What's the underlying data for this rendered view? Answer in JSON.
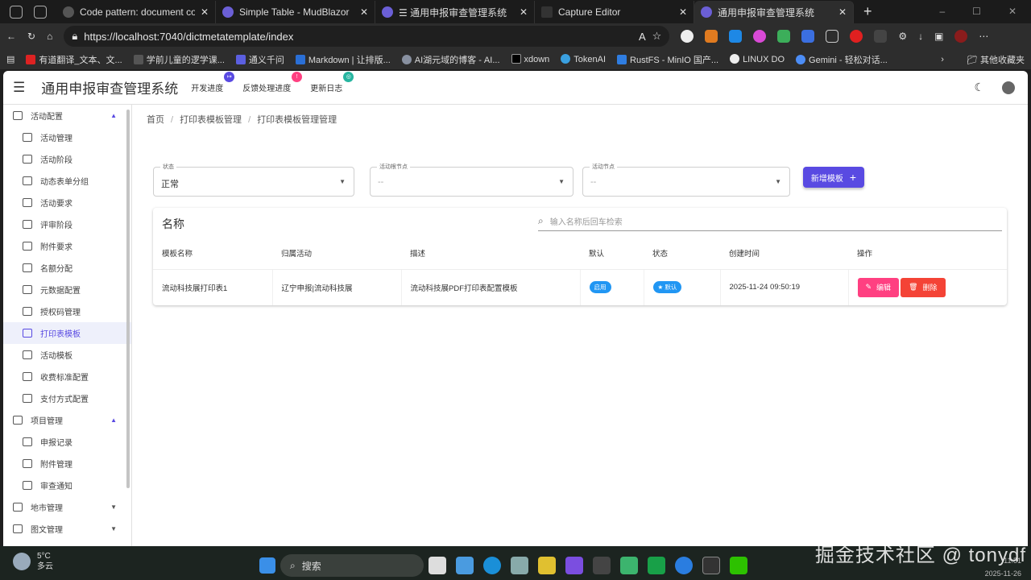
{
  "browser": {
    "tabs": [
      {
        "title": "Code pattern: document code st"
      },
      {
        "title": "Simple Table - MudBlazor"
      },
      {
        "title": "☰ 通用申报审查管理系统"
      },
      {
        "title": "Capture Editor"
      },
      {
        "title": "通用申报审查管理系统",
        "active": true
      }
    ],
    "url": "https://localhost:7040/dictmetatemplate/index",
    "bookmarks": [
      "有道翻译_文本、文...",
      "学前儿童的逻学课...",
      "通义千问",
      "Markdown | 让排版...",
      "AI湖元域的博客 - AI...",
      "xdown",
      "TokenAI",
      "RustFS - MinIO 国产...",
      "LINUX DO",
      "Gemini - 轻松对话..."
    ],
    "other_bookmarks": "其他收藏夹"
  },
  "app": {
    "title": "通用申报审查管理系统",
    "nav": [
      {
        "label": "开发进度",
        "color": "#594ae2"
      },
      {
        "label": "反馈处理进度",
        "color": "#ff4081"
      },
      {
        "label": "更新日志",
        "color": "#26b5a0"
      }
    ]
  },
  "sidebar": {
    "items": [
      {
        "label": "活动配置",
        "group": true,
        "expanded": true
      },
      {
        "label": "活动管理"
      },
      {
        "label": "活动阶段"
      },
      {
        "label": "动态表单分组"
      },
      {
        "label": "活动要求"
      },
      {
        "label": "评审阶段"
      },
      {
        "label": "附件要求"
      },
      {
        "label": "名额分配"
      },
      {
        "label": "元数据配置"
      },
      {
        "label": "授权码管理"
      },
      {
        "label": "打印表模板",
        "active": true
      },
      {
        "label": "活动模板"
      },
      {
        "label": "收费标准配置"
      },
      {
        "label": "支付方式配置"
      },
      {
        "label": "项目管理",
        "group": true,
        "expanded": true
      },
      {
        "label": "申报记录"
      },
      {
        "label": "附件管理"
      },
      {
        "label": "审查通知"
      },
      {
        "label": "地市管理",
        "group": true,
        "expanded": false
      },
      {
        "label": "图文管理",
        "group": true,
        "expanded": false
      }
    ]
  },
  "breadcrumb": [
    "首页",
    "打印表模板管理",
    "打印表模板管理管理"
  ],
  "filters": [
    {
      "label": "状态",
      "value": "正常"
    },
    {
      "label": "活动根节点",
      "value": "--"
    },
    {
      "label": "活动节点",
      "value": "--"
    }
  ],
  "new_button": "新增模板",
  "table": {
    "title": "名称",
    "search_placeholder": "输入名称后回车检索",
    "columns": [
      "模板名称",
      "归属活动",
      "描述",
      "默认",
      "状态",
      "创建时间",
      "操作"
    ],
    "rows": [
      {
        "name": "流动科技展打印表1",
        "activity": "辽宁申报|流动科技展",
        "desc": "流动科技展PDF打印表配置模板",
        "default": "启用",
        "status": "默认",
        "created": "2025-11-24 09:50:19",
        "edit": "编辑",
        "delete": "删除"
      }
    ]
  },
  "taskbar": {
    "temp": "5°C",
    "weather": "多云",
    "search": "搜索",
    "time": "11:51",
    "date": "2025-11-26"
  },
  "watermark": "掘金技术社区 @ tonydf"
}
